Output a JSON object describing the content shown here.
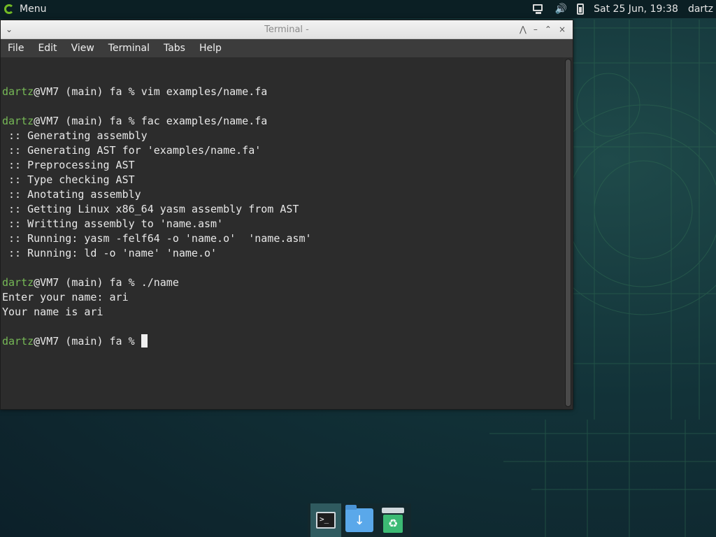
{
  "panel": {
    "menu_label": "Menu",
    "datetime": "Sat 25 Jun, 19:38",
    "user": "dartz",
    "icons": [
      "network-icon",
      "volume-icon",
      "battery-icon"
    ]
  },
  "window": {
    "title": "Terminal -",
    "controls": [
      "pin",
      "minimize",
      "maximize",
      "close"
    ]
  },
  "menubar": {
    "items": [
      "File",
      "Edit",
      "View",
      "Terminal",
      "Tabs",
      "Help"
    ]
  },
  "terminal": {
    "prompt_user": "dartz",
    "prompt_rest": "@VM7 (main) fa % ",
    "lines": [
      {
        "type": "blank"
      },
      {
        "type": "prompt",
        "cmd": "vim examples/name.fa"
      },
      {
        "type": "blank"
      },
      {
        "type": "prompt",
        "cmd": "fac examples/name.fa"
      },
      {
        "type": "out",
        "text": " :: Generating assembly"
      },
      {
        "type": "out",
        "text": " :: Generating AST for 'examples/name.fa'"
      },
      {
        "type": "out",
        "text": " :: Preprocessing AST"
      },
      {
        "type": "out",
        "text": " :: Type checking AST"
      },
      {
        "type": "out",
        "text": " :: Anotating assembly"
      },
      {
        "type": "out",
        "text": " :: Getting Linux x86_64 yasm assembly from AST"
      },
      {
        "type": "out",
        "text": " :: Writting assembly to 'name.asm'"
      },
      {
        "type": "out",
        "text": " :: Running: yasm -felf64 -o 'name.o'  'name.asm'"
      },
      {
        "type": "out",
        "text": " :: Running: ld -o 'name' 'name.o'"
      },
      {
        "type": "blank"
      },
      {
        "type": "prompt",
        "cmd": "./name"
      },
      {
        "type": "out",
        "text": "Enter your name: ari"
      },
      {
        "type": "out",
        "text": "Your name is ari"
      },
      {
        "type": "blank"
      },
      {
        "type": "prompt",
        "cmd": "",
        "cursor": true
      }
    ]
  },
  "dock": {
    "items": [
      {
        "name": "terminal-launcher",
        "icon": "terminal-icon",
        "active": true
      },
      {
        "name": "downloads-folder",
        "icon": "folder-download-icon",
        "active": false
      },
      {
        "name": "trash",
        "icon": "trash-icon",
        "active": false
      }
    ]
  },
  "colors": {
    "prompt_user": "#76b856",
    "terminal_bg": "#2c2c2c",
    "terminal_fg": "#e8e8e8"
  }
}
